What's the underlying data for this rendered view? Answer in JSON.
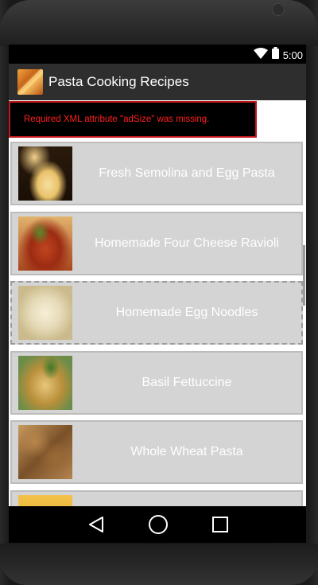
{
  "status_bar": {
    "time": "5:00",
    "icons": [
      "wifi-icon",
      "battery-icon"
    ]
  },
  "app_bar": {
    "title": "Pasta Cooking Recipes",
    "icon": "app-logo"
  },
  "ad_banner": {
    "error_text": "Required XML attribute \"adSize\" was missing.",
    "border_color": "#c0151b",
    "text_color": "#ff2020"
  },
  "recipes": [
    {
      "label": "Fresh Semolina and Egg Pasta"
    },
    {
      "label": "Homemade Four Cheese Ravioli"
    },
    {
      "label": "Homemade Egg Noodles"
    },
    {
      "label": "Basil Fettuccine"
    },
    {
      "label": "Whole Wheat Pasta"
    },
    {
      "label": ""
    }
  ],
  "nav_bar": {
    "buttons": [
      "back-icon",
      "home-icon",
      "recents-icon"
    ]
  }
}
